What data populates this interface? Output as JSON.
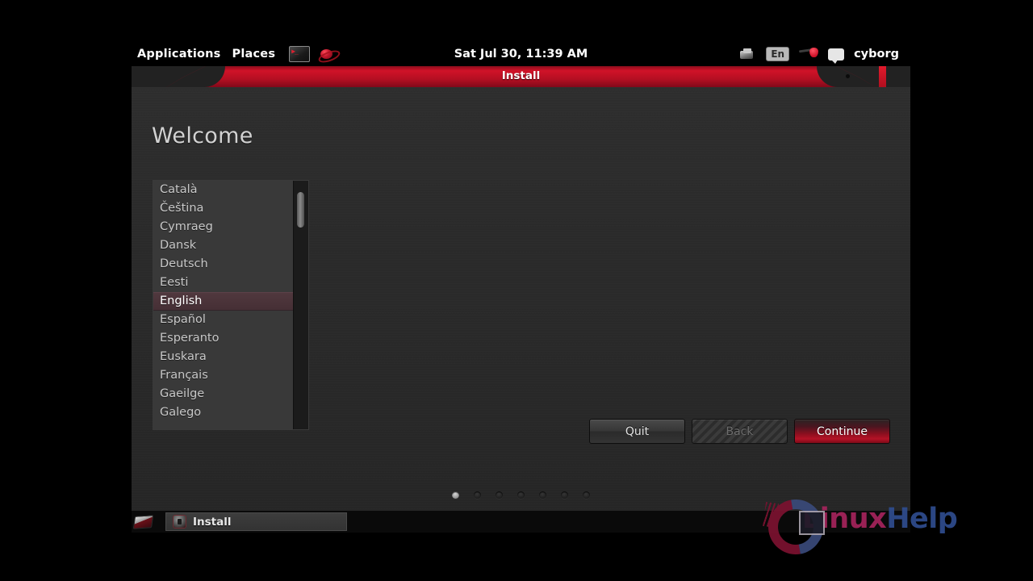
{
  "panel": {
    "menus": [
      {
        "label": "Applications",
        "name": "applications-menu"
      },
      {
        "label": "Places",
        "name": "places-menu"
      }
    ],
    "launchers": [
      {
        "icon": "terminal-icon",
        "name": "terminal-launcher"
      },
      {
        "icon": "browser-icon",
        "name": "browser-launcher"
      }
    ],
    "clock": "Sat Jul 30, 11:39 AM",
    "tray": {
      "printer_icon": "printer-icon",
      "keyboard_layout": "En",
      "network_icon": "network-icon",
      "chat_icon": "chat-icon",
      "user": "cyborg"
    }
  },
  "window": {
    "title": "Install",
    "heading": "Welcome",
    "close_button_label": "",
    "menu_dot_label": ""
  },
  "language_list": {
    "selected": "English",
    "items": [
      "Català",
      "Čeština",
      "Cymraeg",
      "Dansk",
      "Deutsch",
      "Eesti",
      "English",
      "Español",
      "Esperanto",
      "Euskara",
      "Français",
      "Gaeilge",
      "Galego"
    ]
  },
  "buttons": {
    "quit": "Quit",
    "back": "Back",
    "continue": "Continue"
  },
  "progress": {
    "total_steps": 7,
    "current_step": 1
  },
  "taskbar": {
    "show_desktop_name": "show-desktop-icon",
    "window_button": "Install"
  },
  "watermark": {
    "text_part1": "Linux",
    "text_part2": "Help"
  },
  "colors": {
    "accent_red": "#c2162c",
    "titlebar_red": "#d01228",
    "window_bg": "#2a2a2a",
    "list_bg": "#393939",
    "selection": "#4a3338",
    "panel_bg": "#000000",
    "watermark_linux": "#a6245c",
    "watermark_help": "#2f4d8f"
  }
}
